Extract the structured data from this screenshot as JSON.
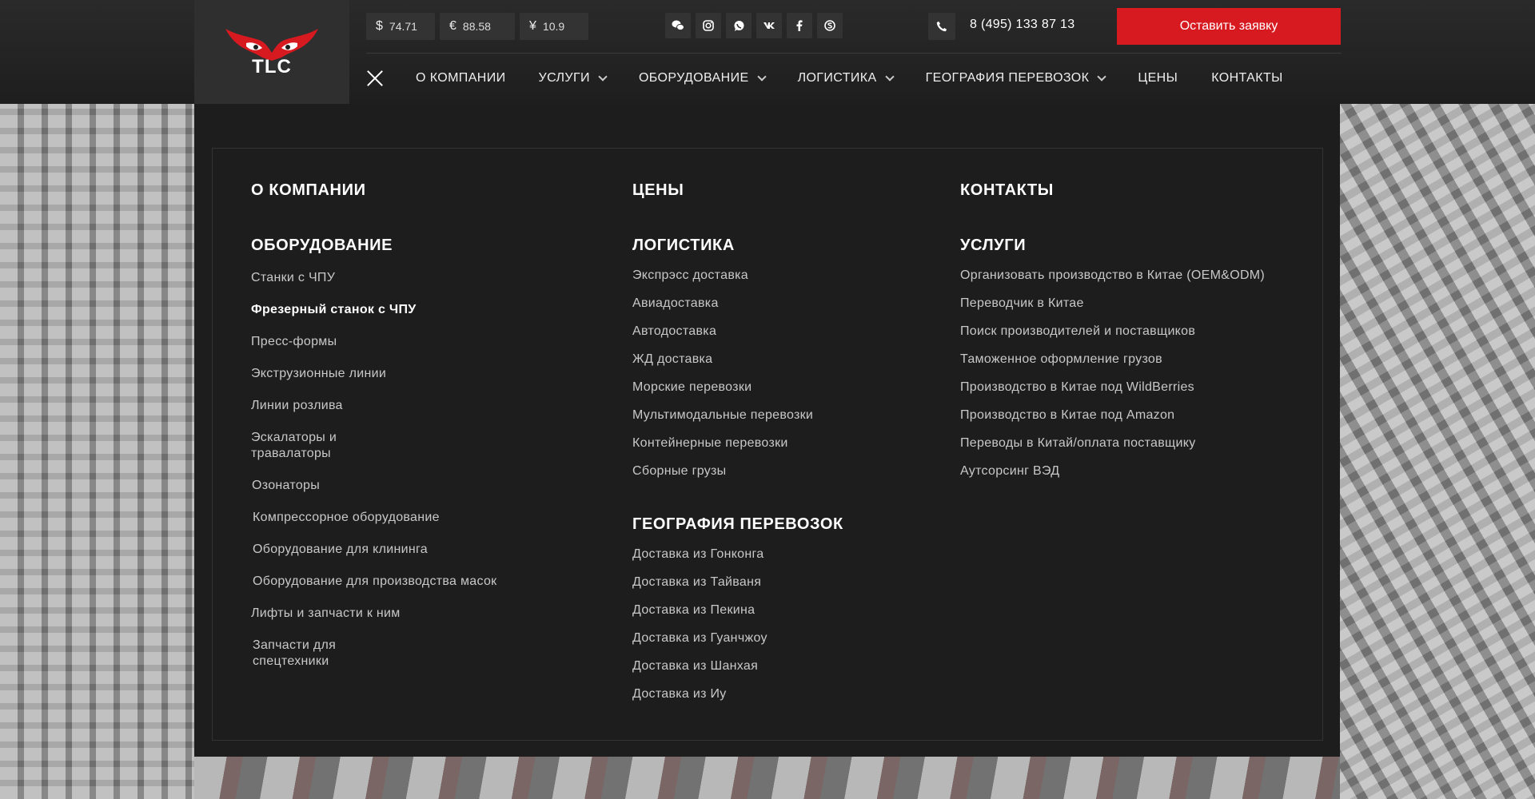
{
  "header": {
    "logo_text": "TLC",
    "rates": [
      {
        "symbol": "$",
        "value": "74.71"
      },
      {
        "symbol": "€",
        "value": "88.58"
      },
      {
        "symbol": "¥",
        "value": "10.9"
      }
    ],
    "socials": [
      "wechat-icon",
      "instagram-icon",
      "whatsapp-icon",
      "vk-icon",
      "facebook-icon",
      "skype-icon"
    ],
    "phone": "8 (495) 133 87 13",
    "cta_label": "Оставить заявку",
    "accent_color": "#d71920"
  },
  "nav": {
    "items": [
      {
        "label": "О КОМПАНИИ",
        "has_dropdown": false
      },
      {
        "label": "УСЛУГИ",
        "has_dropdown": true
      },
      {
        "label": "ОБОРУДОВАНИЕ",
        "has_dropdown": true
      },
      {
        "label": "ЛОГИСТИКА",
        "has_dropdown": true
      },
      {
        "label": "ГЕОГРАФИЯ ПЕРЕВОЗОК",
        "has_dropdown": true
      },
      {
        "label": "ЦЕНЫ",
        "has_dropdown": false
      },
      {
        "label": "КОНТАКТЫ",
        "has_dropdown": false
      }
    ]
  },
  "menu": {
    "about": "О КОМПАНИИ",
    "prices": "ЦЕНЫ",
    "contacts": "КОНТАКТЫ",
    "equipment": {
      "title": "ОБОРУДОВАНИЕ",
      "links": [
        "Станки с ЧПУ",
        "Фрезерный станок с ЧПУ",
        "Пресс-формы",
        "Экструзионные линии",
        "Линии розлива",
        "Эскалаторы и\nтравалаторы",
        "Озонаторы",
        "Компрессорное оборудование",
        "Оборудование для клининга",
        "Оборудование для производства масок",
        "Лифты и запчасти к ним",
        "Запчасти для\nспецтехники"
      ],
      "active_index": 1
    },
    "logistics": {
      "title": "ЛОГИСТИКА",
      "links": [
        "Экспрэсс доставка",
        "Авиадоставка",
        "Автодоставка",
        "ЖД доставка",
        "Морские перевозки",
        "Мультимодальные перевозки",
        "Контейнерные перевозки",
        "Сборные грузы"
      ]
    },
    "geography": {
      "title": "ГЕОГРАФИЯ ПЕРЕВОЗОК",
      "links": [
        "Доставка из Гонконга",
        "Доставка из Тайваня",
        "Доставка из Пекина",
        "Доставка из Гуанчжоу",
        "Доставка из Шанхая",
        "Доставка из Иу"
      ]
    },
    "services": {
      "title": "УСЛУГИ",
      "links": [
        "Организовать производство в Китае (OEM&ODM)",
        "Переводчик в Китае",
        "Поиск производителей и поставщиков",
        "Таможенное оформление грузов",
        "Производство в Китае под WildBerries",
        "Производство в Китае под Amazon",
        "Переводы в Китай/оплата поставщику",
        "Аутсорсинг ВЭД"
      ]
    }
  }
}
